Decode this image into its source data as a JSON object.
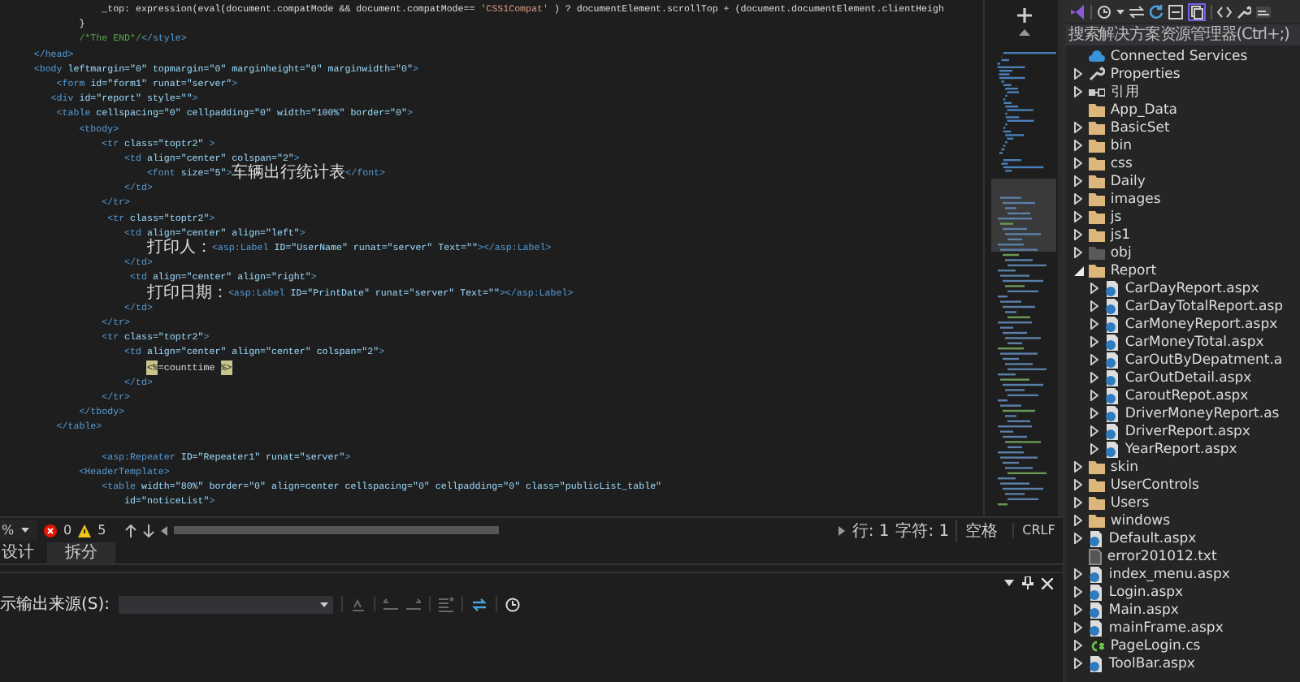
{
  "editor": {
    "lines": [
      {
        "tokens": [
          {
            "kind": "text",
            "text": "                  _top: expression(eval(document.compatMode && document.compatMode== "
          },
          {
            "kind": "string",
            "text": "'CSS1Compat'"
          },
          {
            "kind": "text",
            "text": " ) ? documentElement.scrollTop + (document.documentElement.clientHeigh"
          }
        ]
      },
      {
        "tokens": [
          {
            "kind": "text",
            "text": "              }"
          }
        ]
      },
      {
        "tokens": [
          {
            "kind": "comment",
            "text": "              /*The END*/"
          },
          {
            "kind": "tag",
            "text": "</style>"
          }
        ]
      },
      {
        "tokens": [
          {
            "kind": "tag",
            "text": "      </head>"
          }
        ]
      },
      {
        "tokens": [
          {
            "kind": "tag",
            "text": "      <body"
          },
          {
            "kind": "attr",
            "text": " leftmargin=\"0\" topmargin=\"0\" marginheight=\"0\" marginwidth=\"0\""
          },
          {
            "kind": "tag",
            "text": ">"
          }
        ]
      },
      {
        "tokens": [
          {
            "kind": "tag",
            "text": "          <form"
          },
          {
            "kind": "attr",
            "text": " id=\"form1\" runat=\"server\""
          },
          {
            "kind": "tag",
            "text": ">"
          }
        ]
      },
      {
        "tokens": [
          {
            "kind": "tag",
            "text": "         <div"
          },
          {
            "kind": "attr",
            "text": " id=\"report\" style=\"\""
          },
          {
            "kind": "tag",
            "text": ">"
          }
        ]
      },
      {
        "tokens": [
          {
            "kind": "tag",
            "text": "          <table"
          },
          {
            "kind": "attr",
            "text": " cellspacing=\"0\" cellpadding=\"0\" width=\"100%\" border=\"0\""
          },
          {
            "kind": "tag",
            "text": ">"
          }
        ]
      },
      {
        "tokens": [
          {
            "kind": "tag",
            "text": "              <tbody>"
          }
        ]
      },
      {
        "tokens": [
          {
            "kind": "tag",
            "text": "                  <tr"
          },
          {
            "kind": "attr",
            "text": " class=\"toptr2\" "
          },
          {
            "kind": "tag",
            "text": ">"
          }
        ]
      },
      {
        "tokens": [
          {
            "kind": "tag",
            "text": "                      <td"
          },
          {
            "kind": "attr",
            "text": " align=\"center\" colspan=\"2\""
          },
          {
            "kind": "tag",
            "text": ">"
          }
        ]
      },
      {
        "tokens": [
          {
            "kind": "tag",
            "text": "                          <font"
          },
          {
            "kind": "attr",
            "text": " size=\"5\""
          },
          {
            "kind": "tag",
            "text": ">"
          },
          {
            "kind": "cjk",
            "text": "车辆出行统计表"
          },
          {
            "kind": "tag",
            "text": "</font>"
          }
        ]
      },
      {
        "tokens": [
          {
            "kind": "tag",
            "text": "                      </td>"
          }
        ]
      },
      {
        "tokens": [
          {
            "kind": "tag",
            "text": "                  </tr>"
          }
        ]
      },
      {
        "tokens": [
          {
            "kind": "tag",
            "text": "                   <tr"
          },
          {
            "kind": "attr",
            "text": " class=\"toptr2\""
          },
          {
            "kind": "tag",
            "text": ">"
          }
        ]
      },
      {
        "tokens": [
          {
            "kind": "tag",
            "text": "                      <td"
          },
          {
            "kind": "attr",
            "text": " align=\"center\" align=\"left\""
          },
          {
            "kind": "tag",
            "text": ">"
          }
        ]
      },
      {
        "tokens": [
          {
            "kind": "cjk",
            "text": "                          打印人："
          },
          {
            "kind": "tag",
            "text": "<asp:Label"
          },
          {
            "kind": "attr",
            "text": " ID=\"UserName\" runat=\"server\" Text=\"\""
          },
          {
            "kind": "tag",
            "text": "></asp:Label>"
          }
        ]
      },
      {
        "tokens": [
          {
            "kind": "tag",
            "text": "                      </td>"
          }
        ]
      },
      {
        "tokens": [
          {
            "kind": "tag",
            "text": "                       <td"
          },
          {
            "kind": "attr",
            "text": " align=\"center\" align=\"right\""
          },
          {
            "kind": "tag",
            "text": ">"
          }
        ]
      },
      {
        "tokens": [
          {
            "kind": "cjk",
            "text": "                          打印日期："
          },
          {
            "kind": "tag",
            "text": "<asp:Label"
          },
          {
            "kind": "attr",
            "text": " ID=\"PrintDate\" runat=\"server\" Text=\"\""
          },
          {
            "kind": "tag",
            "text": "></asp:Label>"
          }
        ]
      },
      {
        "tokens": [
          {
            "kind": "tag",
            "text": "                      </td>"
          }
        ]
      },
      {
        "tokens": [
          {
            "kind": "tag",
            "text": "                  </tr>"
          }
        ]
      },
      {
        "tokens": [
          {
            "kind": "tag",
            "text": "                  <tr"
          },
          {
            "kind": "attr",
            "text": " class=\"toptr2\""
          },
          {
            "kind": "tag",
            "text": ">"
          }
        ]
      },
      {
        "tokens": [
          {
            "kind": "tag",
            "text": "                      <td"
          },
          {
            "kind": "attr",
            "text": " align=\"center\" align=\"center\" colspan=\"2\""
          },
          {
            "kind": "tag",
            "text": ">"
          }
        ]
      },
      {
        "tokens": [
          {
            "kind": "delim",
            "text": "                          <%"
          },
          {
            "kind": "text",
            "text": "=counttime "
          },
          {
            "kind": "delim",
            "text": "%>"
          }
        ]
      },
      {
        "tokens": [
          {
            "kind": "tag",
            "text": "                      </td>"
          }
        ]
      },
      {
        "tokens": [
          {
            "kind": "tag",
            "text": "                  </tr>"
          }
        ]
      },
      {
        "tokens": [
          {
            "kind": "tag",
            "text": "              </tbody>"
          }
        ]
      },
      {
        "tokens": [
          {
            "kind": "tag",
            "text": "          </table>"
          }
        ]
      },
      {
        "kind": "blank"
      },
      {
        "tokens": [
          {
            "kind": "tag",
            "text": "                  <asp:Repeater"
          },
          {
            "kind": "attr",
            "text": " ID=\"Repeater1\" runat=\"server\""
          },
          {
            "kind": "tag",
            "text": ">"
          }
        ]
      },
      {
        "tokens": [
          {
            "kind": "tag",
            "text": "              <HeaderTemplate>"
          }
        ]
      },
      {
        "tokens": [
          {
            "kind": "tag",
            "text": "                  <table"
          },
          {
            "kind": "attr",
            "text": " width=\"80%\" border=\"0\" align=center cellspacing=\"0\" cellpadding=\"0\" class=\"publicList_table\""
          }
        ]
      },
      {
        "tokens": [
          {
            "kind": "attr",
            "text": "                      id=\"noticeList\""
          },
          {
            "kind": "tag",
            "text": ">"
          }
        ]
      }
    ]
  },
  "status_bar": {
    "zoom": "%",
    "errors": "0",
    "warnings": "5",
    "line": "行: 1",
    "char": "字符: 1",
    "indent": "空格",
    "eol": "CRLF"
  },
  "view_tabs": [
    {
      "label": "设计",
      "selected": false
    },
    {
      "label": "拆分",
      "selected": true
    }
  ],
  "output": {
    "source_label": "示输出来源(S):"
  },
  "solution_explorer": {
    "search": {
      "placeholder": "搜索解决方案资源管理器(Ctrl+;)"
    },
    "items": [
      {
        "label": "Connected Services",
        "kind": "service",
        "expander": false
      },
      {
        "label": "Properties",
        "kind": "wrench",
        "expander": true,
        "expanded": false
      },
      {
        "label": "引用",
        "kind": "refs",
        "expander": true,
        "expanded": false
      },
      {
        "label": "App_Data",
        "kind": "folder",
        "expander": false
      },
      {
        "label": "BasicSet",
        "kind": "folder",
        "expander": true,
        "expanded": false
      },
      {
        "label": "bin",
        "kind": "folder",
        "expander": true,
        "expanded": false
      },
      {
        "label": "css",
        "kind": "folder",
        "expander": true,
        "expanded": false
      },
      {
        "label": "Daily",
        "kind": "folder",
        "expander": true,
        "expanded": false
      },
      {
        "label": "images",
        "kind": "folder",
        "expander": true,
        "expanded": false
      },
      {
        "label": "js",
        "kind": "folder",
        "expander": true,
        "expanded": false
      },
      {
        "label": "js1",
        "kind": "folder",
        "expander": true,
        "expanded": false
      },
      {
        "label": "obj",
        "kind": "folder-dim",
        "expander": true,
        "expanded": false
      },
      {
        "label": "Report",
        "kind": "folder",
        "expander": true,
        "expanded": true,
        "children": [
          {
            "label": "CarDayReport.aspx",
            "kind": "aspx",
            "expander": true,
            "expanded": false
          },
          {
            "label": "CarDayTotalReport.asp",
            "kind": "aspx",
            "expander": true,
            "expanded": false
          },
          {
            "label": "CarMoneyReport.aspx",
            "kind": "aspx",
            "expander": true,
            "expanded": false
          },
          {
            "label": "CarMoneyTotal.aspx",
            "kind": "aspx",
            "expander": true,
            "expanded": false
          },
          {
            "label": "CarOutByDepatment.a",
            "kind": "aspx",
            "expander": true,
            "expanded": false
          },
          {
            "label": "CarOutDetail.aspx",
            "kind": "aspx",
            "expander": true,
            "expanded": false
          },
          {
            "label": "CaroutRepot.aspx",
            "kind": "aspx",
            "expander": true,
            "expanded": false
          },
          {
            "label": "DriverMoneyReport.as",
            "kind": "aspx",
            "expander": true,
            "expanded": false
          },
          {
            "label": "DriverReport.aspx",
            "kind": "aspx",
            "expander": true,
            "expanded": false
          },
          {
            "label": "YearReport.aspx",
            "kind": "aspx",
            "expander": true,
            "expanded": false
          }
        ]
      },
      {
        "label": "skin",
        "kind": "folder",
        "expander": true,
        "expanded": false
      },
      {
        "label": "UserControls",
        "kind": "folder",
        "expander": true,
        "expanded": false
      },
      {
        "label": "Users",
        "kind": "folder",
        "expander": true,
        "expanded": false
      },
      {
        "label": "windows",
        "kind": "folder",
        "expander": true,
        "expanded": false
      },
      {
        "label": "Default.aspx",
        "kind": "aspx",
        "expander": true,
        "expanded": false
      },
      {
        "label": "error201012.txt",
        "kind": "txt",
        "expander": false
      },
      {
        "label": "index_menu.aspx",
        "kind": "aspx",
        "expander": true,
        "expanded": false
      },
      {
        "label": "Login.aspx",
        "kind": "aspx",
        "expander": true,
        "expanded": false
      },
      {
        "label": "Main.aspx",
        "kind": "aspx",
        "expander": true,
        "expanded": false
      },
      {
        "label": "mainFrame.aspx",
        "kind": "aspx",
        "expander": true,
        "expanded": false
      },
      {
        "label": "PageLogin.cs",
        "kind": "cs",
        "expander": true,
        "expanded": false
      },
      {
        "label": "ToolBar.aspx",
        "kind": "aspx",
        "expander": true,
        "expanded": false
      }
    ]
  }
}
